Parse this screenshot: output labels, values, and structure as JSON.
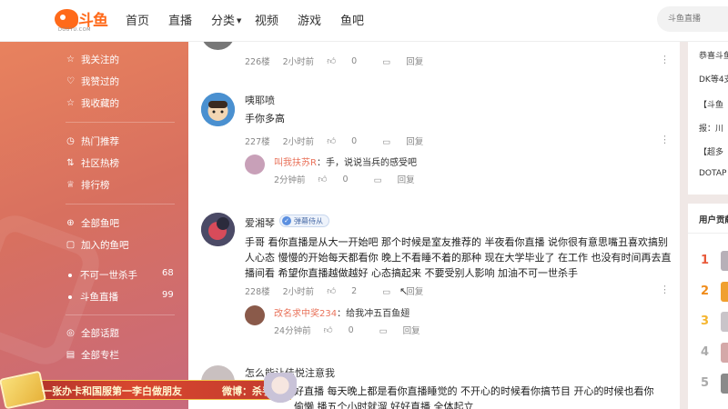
{
  "topnav": {
    "logo_text": "斗鱼",
    "logo_sub": "DOUYU.COM",
    "items": [
      "首页",
      "直播",
      "分类",
      "视频",
      "游戏",
      "鱼吧"
    ],
    "search_placeholder": "斗鱼直播"
  },
  "sidebar": {
    "group1": [
      "我关注的",
      "我赞过的",
      "我收藏的"
    ],
    "group2": [
      "热门推荐",
      "社区热榜",
      "排行榜"
    ],
    "group3": [
      "全部鱼吧",
      "加入的鱼吧"
    ],
    "bars": [
      {
        "label": "不可一世杀手",
        "count": "68"
      },
      {
        "label": "斗鱼直播",
        "count": "99"
      }
    ],
    "group4": [
      "全部话题",
      "全部专栏"
    ]
  },
  "comments": [
    {
      "text_top": "",
      "floor": "226楼",
      "time": "2小时前",
      "likes": "0",
      "reply_label": "回复"
    },
    {
      "username": "咦耶喷",
      "text": "手你多高",
      "floor": "227楼",
      "time": "2小时前",
      "likes": "0",
      "reply_label": "回复",
      "reply": {
        "name": "叫我扶苏R",
        "text": "：手，说说当兵的感受吧",
        "time": "2分钟前",
        "likes": "0",
        "reply_label": "回复"
      }
    },
    {
      "username": "爱湘琴",
      "badge": "弹幕侍从",
      "text": "手哥 看你直播是从大一开始吧 那个时候是室友推荐的 半夜看你直播 说你很有意思嘴丑喜欢搞别人心态 慢慢的开始每天都看你 晚上不看睡不着的那种 现在大学毕业了 在工作 也没有时间再去直播间看 希望你直播越做越好 心态搞起来 不要受别人影响 加油不可一世杀手",
      "floor": "228楼",
      "time": "2小时前",
      "likes": "2",
      "reply_label": "回复",
      "reply": {
        "name": "改名求中奖234",
        "text": "：给我冲五百鱼翅",
        "time": "24分钟前",
        "likes": "0",
        "reply_label": "回复"
      }
    },
    {
      "username": "怎么能让佳悦注意我",
      "text": "好直播 每天晚上都是看你直播睡觉的 不开心的时候看你搞节目 开心的时候也看你",
      "text2": "偷懒 播五个小时就溜 好好直播 全体起立"
    }
  ],
  "right": {
    "lines1": [
      "恭喜斗鱼",
      "DK等4支",
      "【斗鱼",
      "报：川",
      "【超多",
      "DOTAP"
    ],
    "panel2_title": "用户贡献",
    "ranks": [
      "1",
      "2",
      "3",
      "4",
      "5"
    ]
  },
  "banner": {
    "text1": "一张办卡和国服第一李白做朋友",
    "text2": "微博：杀手SS"
  },
  "colors": {
    "accent": "#ff6a1a",
    "sidebar_top": "#e8825e",
    "sidebar_bottom": "#c86a7c",
    "reply_name": "#e9735b",
    "rank1": "#e85a3a",
    "rank2": "#f08c1a",
    "rank3": "#f5b52e"
  }
}
